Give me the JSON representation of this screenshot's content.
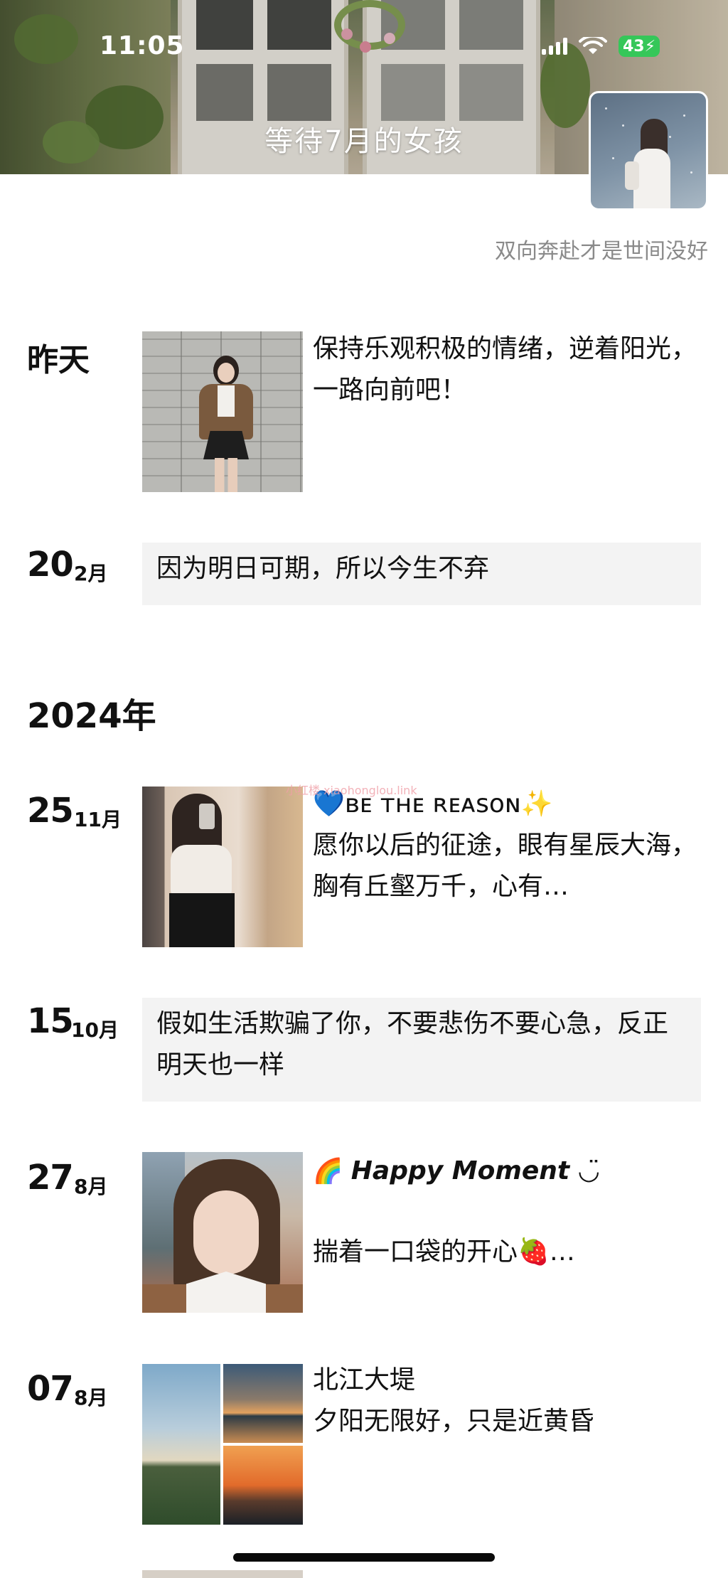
{
  "status_bar": {
    "time": "11:05",
    "battery": "43"
  },
  "cover": {
    "title": "等待7月的女孩"
  },
  "profile": {
    "signature": "双向奔赴才是世间没好"
  },
  "posts": [
    {
      "date_word": "昨天",
      "text": "保持乐观积极的情绪，逆着阳光，一路向前吧！",
      "image": "wall-portrait"
    },
    {
      "day": "20",
      "month": "2月",
      "text": "因为明日可期，所以今生不弃"
    }
  ],
  "year_header": "2024年",
  "posts_2024": [
    {
      "day": "25",
      "month": "11月",
      "line1": "💙ʙᴇ ᴛʜᴇ ʀᴇᴀꜱᴏɴ✨",
      "line2": "愿你以后的征途，眼有星辰大海，胸有丘壑万千，心有…",
      "image": "mirror-selfie"
    },
    {
      "day": "15",
      "month": "10月",
      "text": "假如生活欺骗了你，不要悲伤不要心急，反正明天也一样"
    },
    {
      "day": "27",
      "month": "8月",
      "line1_emoji": "🌈",
      "line1": "Happy Moment",
      "line1_end": "◡̈",
      "line2": "揣着一口袋的开心🍓…",
      "image": "selfie"
    },
    {
      "day": "07",
      "month": "8月",
      "line1": "北江大堤",
      "line2": "夕阳无限好，只是近黄昏",
      "image": "sunset-collage"
    }
  ],
  "watermark": "小红楼 xiaohonglou.link",
  "colors": {
    "battery": "#35c759",
    "text_box_bg": "#f3f3f3",
    "signature_text": "#8a8a8a"
  }
}
